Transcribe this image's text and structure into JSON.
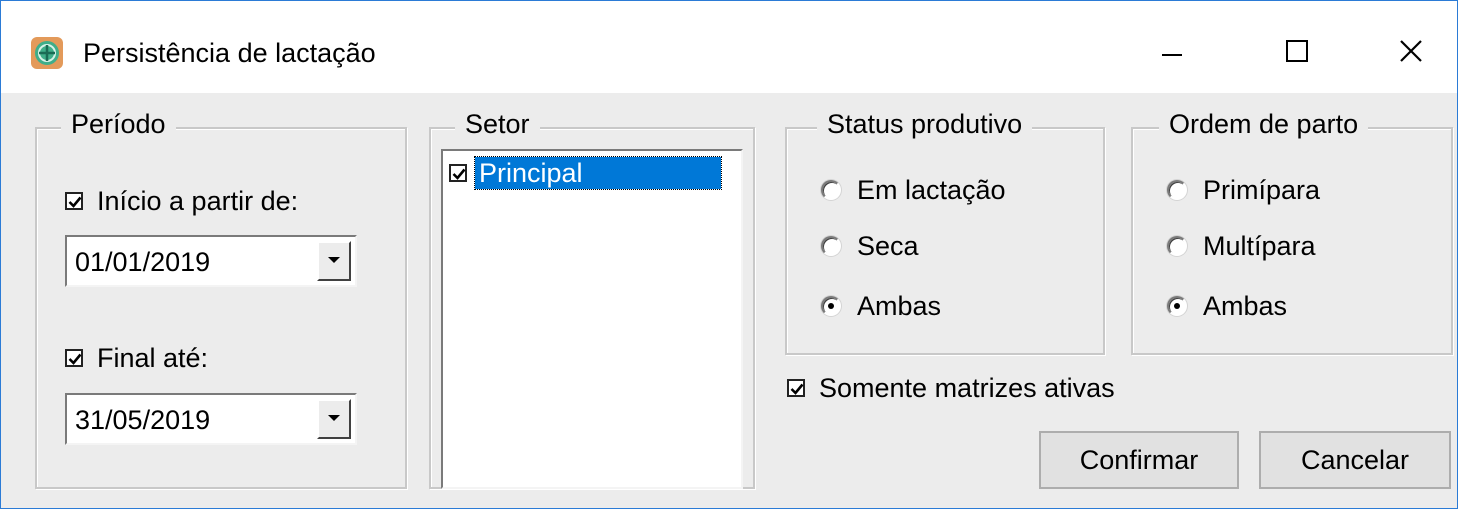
{
  "window": {
    "title": "Persistência de lactação",
    "icon": "app-logo-icon",
    "controls": {
      "minimize": "minimize-icon",
      "maximize": "maximize-icon",
      "close": "close-icon"
    }
  },
  "periodo": {
    "legend": "Período",
    "inicio": {
      "label": "Início a partir de:",
      "checked": true,
      "value": "01/01/2019"
    },
    "final": {
      "label": "Final até:",
      "checked": true,
      "value": "31/05/2019"
    }
  },
  "setor": {
    "legend": "Setor",
    "items": [
      {
        "label": "Principal",
        "checked": true,
        "selected": true
      }
    ]
  },
  "status_produtivo": {
    "legend": "Status produtivo",
    "options": [
      "Em lactação",
      "Seca",
      "Ambas"
    ],
    "selected": "Ambas"
  },
  "ordem_parto": {
    "legend": "Ordem de parto",
    "options": [
      "Primípara",
      "Multípara",
      "Ambas"
    ],
    "selected": "Ambas"
  },
  "somente_ativas": {
    "label": "Somente matrizes ativas",
    "checked": true
  },
  "buttons": {
    "confirm": "Confirmar",
    "cancel": "Cancelar"
  },
  "colors": {
    "selection": "#0078d7",
    "window_border": "#2b7bd6",
    "dialog_bg": "#ececec"
  }
}
